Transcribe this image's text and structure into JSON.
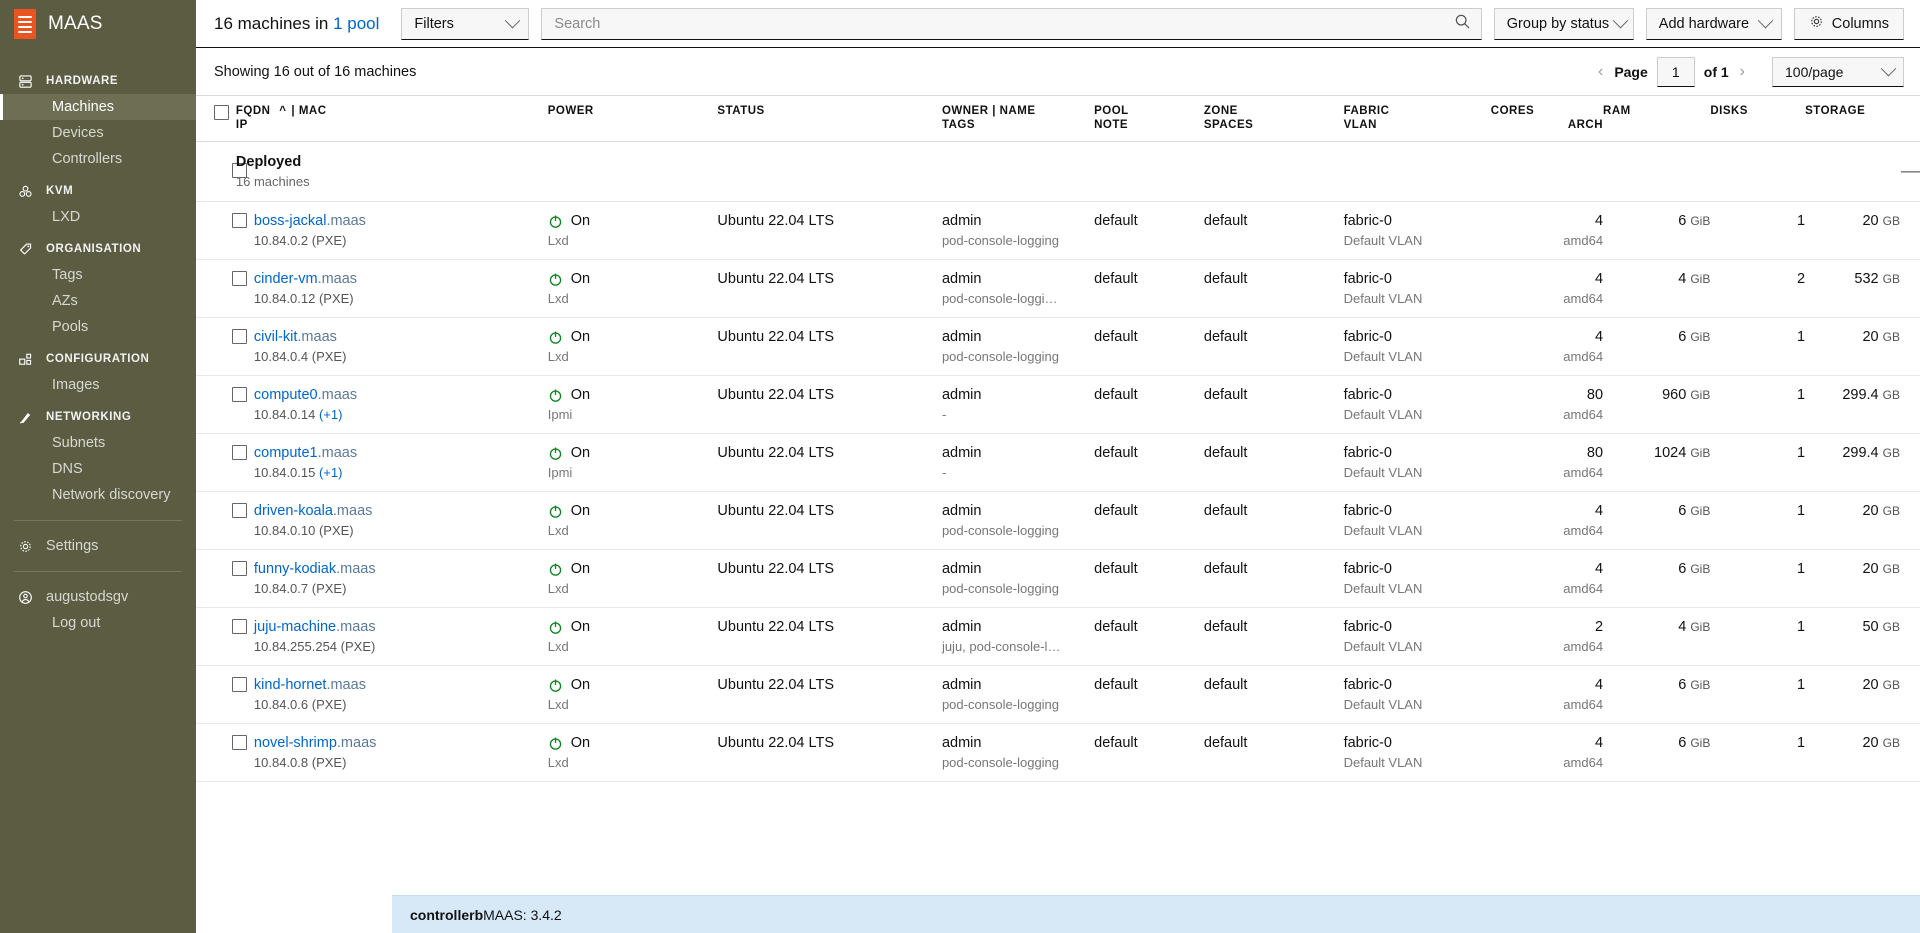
{
  "brand": {
    "name": "MAAS",
    "logo_icon": "maas-logo-icon"
  },
  "sidebar": {
    "sections": [
      {
        "label": "HARDWARE",
        "icon": "server-icon",
        "items": [
          {
            "label": "Machines",
            "active": true
          },
          {
            "label": "Devices",
            "active": false
          },
          {
            "label": "Controllers",
            "active": false
          }
        ]
      },
      {
        "label": "KVM",
        "icon": "kvm-icon",
        "items": [
          {
            "label": "LXD",
            "active": false
          }
        ]
      },
      {
        "label": "ORGANISATION",
        "icon": "tag-icon",
        "items": [
          {
            "label": "Tags",
            "active": false
          },
          {
            "label": "AZs",
            "active": false
          },
          {
            "label": "Pools",
            "active": false
          }
        ]
      },
      {
        "label": "CONFIGURATION",
        "icon": "blocks-icon",
        "items": [
          {
            "label": "Images",
            "active": false
          }
        ]
      },
      {
        "label": "NETWORKING",
        "icon": "network-icon",
        "items": [
          {
            "label": "Subnets",
            "active": false
          },
          {
            "label": "DNS",
            "active": false
          },
          {
            "label": "Network discovery",
            "active": false
          }
        ]
      }
    ],
    "settings": {
      "label": "Settings",
      "icon": "gear-icon"
    },
    "user": {
      "label": "augustodsgv",
      "icon": "user-icon"
    },
    "logout": {
      "label": "Log out"
    }
  },
  "toolbar": {
    "count_prefix": "16 machines in ",
    "pool_link": "1 pool",
    "filters_label": "Filters",
    "search_value": "",
    "search_placeholder": "Search",
    "search_icon": "search-icon",
    "group_by_label": "Group by status",
    "add_hardware_label": "Add hardware",
    "columns_label": "Columns",
    "columns_icon": "gear-icon"
  },
  "subbar": {
    "showing": "Showing 16 out of 16 machines",
    "page_label": "Page",
    "page_value": "1",
    "of_label": "of 1",
    "prev_icon": "chevron-left-icon",
    "next_icon": "chevron-right-icon",
    "per_page": "100/page"
  },
  "table": {
    "headers": [
      {
        "main": "FQDN",
        "sub": "IP",
        "sort_icon": "sort-asc-icon",
        "extra": "| MAC"
      },
      {
        "main": "POWER",
        "sub": ""
      },
      {
        "main": "STATUS",
        "sub": ""
      },
      {
        "main": "OWNER | NAME",
        "sub": "TAGS"
      },
      {
        "main": "POOL",
        "sub": "NOTE"
      },
      {
        "main": "ZONE",
        "sub": "SPACES"
      },
      {
        "main": "FABRIC",
        "sub": "VLAN"
      },
      {
        "main": "CORES",
        "sub": "ARCH"
      },
      {
        "main": "RAM",
        "sub": ""
      },
      {
        "main": "DISKS",
        "sub": ""
      },
      {
        "main": "STORAGE",
        "sub": ""
      }
    ],
    "group": {
      "name": "Deployed",
      "count": "16 machines",
      "collapse_icon": "minus-icon"
    },
    "rows": [
      {
        "host": "boss-jackal",
        "domain": ".maas",
        "ip": "10.84.0.2 (PXE)",
        "extra_ip": "",
        "power": "On",
        "power_sub": "Lxd",
        "status": "Ubuntu 22.04 LTS",
        "owner": "admin",
        "tags": "pod-console-logging",
        "pool": "default",
        "note": "",
        "zone": "default",
        "spaces": "",
        "fabric": "fabric-0",
        "vlan": "Default VLAN",
        "cores": "4",
        "arch": "amd64",
        "ram": "6",
        "ram_unit": "GiB",
        "disks": "1",
        "storage": "20",
        "storage_unit": "GB"
      },
      {
        "host": "cinder-vm",
        "domain": ".maas",
        "ip": "10.84.0.12 (PXE)",
        "extra_ip": "",
        "power": "On",
        "power_sub": "Lxd",
        "status": "Ubuntu 22.04 LTS",
        "owner": "admin",
        "tags": "pod-console-loggi…",
        "pool": "default",
        "note": "",
        "zone": "default",
        "spaces": "",
        "fabric": "fabric-0",
        "vlan": "Default VLAN",
        "cores": "4",
        "arch": "amd64",
        "ram": "4",
        "ram_unit": "GiB",
        "disks": "2",
        "storage": "532",
        "storage_unit": "GB"
      },
      {
        "host": "civil-kit",
        "domain": ".maas",
        "ip": "10.84.0.4 (PXE)",
        "extra_ip": "",
        "power": "On",
        "power_sub": "Lxd",
        "status": "Ubuntu 22.04 LTS",
        "owner": "admin",
        "tags": "pod-console-logging",
        "pool": "default",
        "note": "",
        "zone": "default",
        "spaces": "",
        "fabric": "fabric-0",
        "vlan": "Default VLAN",
        "cores": "4",
        "arch": "amd64",
        "ram": "6",
        "ram_unit": "GiB",
        "disks": "1",
        "storage": "20",
        "storage_unit": "GB"
      },
      {
        "host": "compute0",
        "domain": ".maas",
        "ip": "10.84.0.14 ",
        "extra_ip": "(+1)",
        "power": "On",
        "power_sub": "Ipmi",
        "status": "Ubuntu 22.04 LTS",
        "owner": "admin",
        "tags": "-",
        "pool": "default",
        "note": "",
        "zone": "default",
        "spaces": "",
        "fabric": "fabric-0",
        "vlan": "Default VLAN",
        "cores": "80",
        "arch": "amd64",
        "ram": "960",
        "ram_unit": "GiB",
        "disks": "1",
        "storage": "299.4",
        "storage_unit": "GB"
      },
      {
        "host": "compute1",
        "domain": ".maas",
        "ip": "10.84.0.15 ",
        "extra_ip": "(+1)",
        "power": "On",
        "power_sub": "Ipmi",
        "status": "Ubuntu 22.04 LTS",
        "owner": "admin",
        "tags": "-",
        "pool": "default",
        "note": "",
        "zone": "default",
        "spaces": "",
        "fabric": "fabric-0",
        "vlan": "Default VLAN",
        "cores": "80",
        "arch": "amd64",
        "ram": "1024",
        "ram_unit": "GiB",
        "disks": "1",
        "storage": "299.4",
        "storage_unit": "GB"
      },
      {
        "host": "driven-koala",
        "domain": ".maas",
        "ip": "10.84.0.10 (PXE)",
        "extra_ip": "",
        "power": "On",
        "power_sub": "Lxd",
        "status": "Ubuntu 22.04 LTS",
        "owner": "admin",
        "tags": "pod-console-logging",
        "pool": "default",
        "note": "",
        "zone": "default",
        "spaces": "",
        "fabric": "fabric-0",
        "vlan": "Default VLAN",
        "cores": "4",
        "arch": "amd64",
        "ram": "6",
        "ram_unit": "GiB",
        "disks": "1",
        "storage": "20",
        "storage_unit": "GB"
      },
      {
        "host": "funny-kodiak",
        "domain": ".maas",
        "ip": "10.84.0.7 (PXE)",
        "extra_ip": "",
        "power": "On",
        "power_sub": "Lxd",
        "status": "Ubuntu 22.04 LTS",
        "owner": "admin",
        "tags": "pod-console-logging",
        "pool": "default",
        "note": "",
        "zone": "default",
        "spaces": "",
        "fabric": "fabric-0",
        "vlan": "Default VLAN",
        "cores": "4",
        "arch": "amd64",
        "ram": "6",
        "ram_unit": "GiB",
        "disks": "1",
        "storage": "20",
        "storage_unit": "GB"
      },
      {
        "host": "juju-machine",
        "domain": ".maas",
        "ip": "10.84.255.254 (PXE)",
        "extra_ip": "",
        "power": "On",
        "power_sub": "Lxd",
        "status": "Ubuntu 22.04 LTS",
        "owner": "admin",
        "tags": "juju, pod-console-l…",
        "pool": "default",
        "note": "",
        "zone": "default",
        "spaces": "",
        "fabric": "fabric-0",
        "vlan": "Default VLAN",
        "cores": "2",
        "arch": "amd64",
        "ram": "4",
        "ram_unit": "GiB",
        "disks": "1",
        "storage": "50",
        "storage_unit": "GB"
      },
      {
        "host": "kind-hornet",
        "domain": ".maas",
        "ip": "10.84.0.6 (PXE)",
        "extra_ip": "",
        "power": "On",
        "power_sub": "Lxd",
        "status": "Ubuntu 22.04 LTS",
        "owner": "admin",
        "tags": "pod-console-logging",
        "pool": "default",
        "note": "",
        "zone": "default",
        "spaces": "",
        "fabric": "fabric-0",
        "vlan": "Default VLAN",
        "cores": "4",
        "arch": "amd64",
        "ram": "6",
        "ram_unit": "GiB",
        "disks": "1",
        "storage": "20",
        "storage_unit": "GB"
      },
      {
        "host": "novel-shrimp",
        "domain": ".maas",
        "ip": "10.84.0.8 (PXE)",
        "extra_ip": "",
        "power": "On",
        "power_sub": "Lxd",
        "status": "Ubuntu 22.04 LTS",
        "owner": "admin",
        "tags": "pod-console-logging",
        "pool": "default",
        "note": "",
        "zone": "default",
        "spaces": "",
        "fabric": "fabric-0",
        "vlan": "Default VLAN",
        "cores": "4",
        "arch": "amd64",
        "ram": "6",
        "ram_unit": "GiB",
        "disks": "1",
        "storage": "20",
        "storage_unit": "GB"
      }
    ]
  },
  "statusbar": {
    "host": "controllerb",
    "text": " MAAS: 3.4.2"
  }
}
